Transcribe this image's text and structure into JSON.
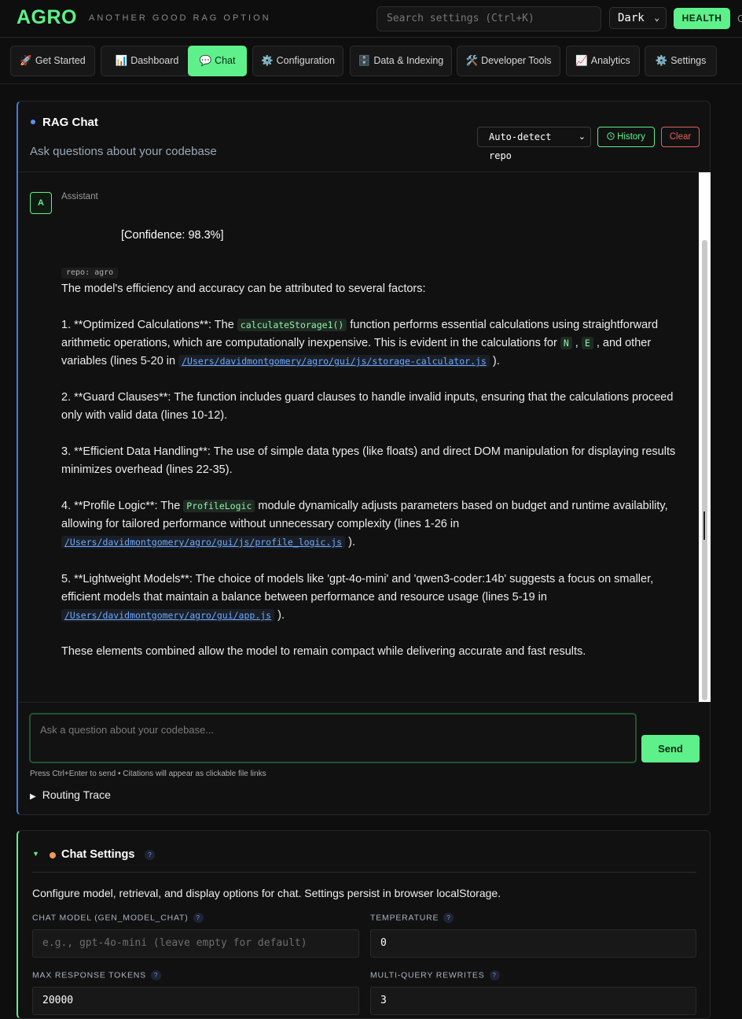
{
  "header": {
    "brand": "AGRO",
    "tagline": "ANOTHER GOOD RAG OPTION",
    "search_placeholder": "Search settings (Ctrl+K)",
    "theme_value": "Dark",
    "health_label": "HEALTH"
  },
  "nav": {
    "tabs": [
      {
        "icon": "🚀",
        "label": "Get Started"
      },
      {
        "icon": "📊",
        "label": "Dashboard"
      },
      {
        "icon": "💬",
        "label": "Chat"
      },
      {
        "icon": "⚙️",
        "label": "Configuration"
      },
      {
        "icon": "🗄️",
        "label": "Data & Indexing"
      },
      {
        "icon": "🛠️",
        "label": "Developer Tools"
      },
      {
        "icon": "📈",
        "label": "Analytics"
      },
      {
        "icon": "⚙️",
        "label": "Settings"
      }
    ],
    "active": "Chat"
  },
  "chat": {
    "title": "RAG Chat",
    "subtitle": "Ask questions about your codebase",
    "repo_select": "Auto-detect repo",
    "history_label": "History",
    "clear_label": "Clear",
    "message": {
      "avatar": "A",
      "role": "Assistant",
      "confidence": "[Confidence: 98.3%]",
      "repo_tag": "repo: agro",
      "intro": "The model's efficiency and accuracy can be attributed to several factors:",
      "p1_a": "1. **Optimized Calculations**: The ",
      "p1_code": "calculateStorage1()",
      "p1_b": " function performs essential calculations using straightforward",
      "p1_line2_a": "arithmetic operations, which are computationally inexpensive. This is evident in the calculations for ",
      "p1_code_n": "N",
      "p1_sep": " , ",
      "p1_code_e": "E",
      "p1_line2_b": " , and other",
      "p1_line3_a": "variables (lines 5-20 in ",
      "p1_link": "/Users/davidmontgomery/agro/gui/js/storage-calculator.js",
      "p1_line3_b": " ).",
      "p2_line1": "2. **Guard Clauses**: The function includes guard clauses to handle invalid inputs, ensuring that the calculations proceed",
      "p2_line2": "only with valid data (lines 10-12).",
      "p3_line1": "3. **Efficient Data Handling**: The use of simple data types (like floats) and direct DOM manipulation for displaying results",
      "p3_line2": "minimizes overhead (lines 22-35).",
      "p4_a": "4. **Profile Logic**: The ",
      "p4_code": "ProfileLogic",
      "p4_b": " module dynamically adjusts parameters based on budget and runtime availability,",
      "p4_line2": "allowing for tailored performance without unnecessary complexity (lines 1-26 in",
      "p4_link": "/Users/davidmontgomery/agro/gui/js/profile_logic.js",
      "p4_end": " ).",
      "p5_line1": "5. **Lightweight Models**: The choice of models like 'gpt-4o-mini' and 'qwen3-coder:14b' suggests a focus on smaller,",
      "p5_line2": "efficient models that maintain a balance between performance and resource usage (lines 5-19 in",
      "p5_link": "/Users/davidmontgomery/agro/gui/app.js",
      "p5_end": " ).",
      "conclusion": "These elements combined allow the model to remain compact while delivering accurate and fast results."
    },
    "input_placeholder": "Ask a question about your codebase...",
    "send_label": "Send",
    "hint": "Press Ctrl+Enter to send • Citations will appear as clickable file links",
    "routing_trace": "Routing Trace"
  },
  "settings": {
    "title": "Chat Settings",
    "help": "?",
    "description": "Configure model, retrieval, and display options for chat. Settings persist in browser localStorage.",
    "fields": [
      {
        "label": "CHAT MODEL (GEN_MODEL_CHAT)",
        "value": "",
        "placeholder": "e.g., gpt-4o-mini (leave empty for default)"
      },
      {
        "label": "TEMPERATURE",
        "value": "0"
      },
      {
        "label": "MAX RESPONSE TOKENS",
        "value": "20000"
      },
      {
        "label": "MULTI-QUERY REWRITES",
        "value": "3"
      }
    ]
  },
  "colors": {
    "accent": "#5ef08a",
    "link": "#6ea8ff",
    "danger": "#e0625a",
    "chat_border": "#3f7de0",
    "settings_dot": "#f0975a"
  }
}
